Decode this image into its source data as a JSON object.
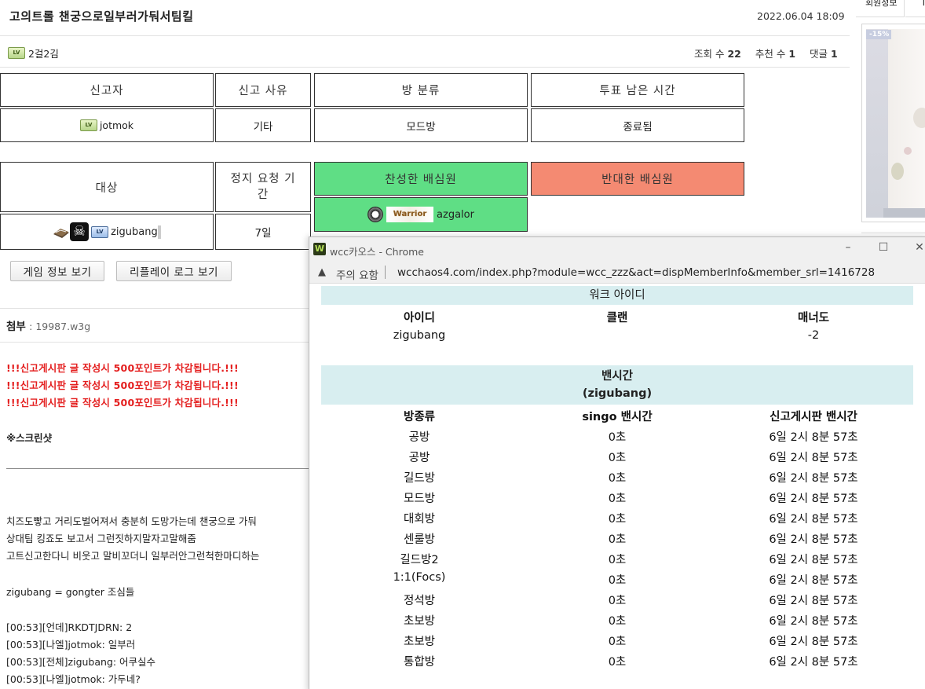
{
  "post": {
    "title": "고의트롤 챈궁으로일부러가둬서팀킬",
    "date": "2022.06.04 18:09",
    "author": "2걸2김",
    "views_label": "조회 수",
    "views": "22",
    "recommend_label": "추천 수",
    "recommend": "1",
    "comments_label": "댓글",
    "comments": "1"
  },
  "sidebar": {
    "tab1": "회원정보",
    "promo_tag": "-15%"
  },
  "report": {
    "headers": [
      "신고자",
      "신고 사유",
      "방 분류",
      "투표 남은 시간"
    ],
    "reporter": "jotmok",
    "reason": "기타",
    "room_type": "모드방",
    "time_left": "종료됨"
  },
  "target": {
    "header": "대상",
    "duration_header": "정지 요청 기간",
    "name": "zigubang",
    "duration": "7일",
    "agree_header": "찬성한 배심원",
    "disagree_header": "반대한 배심원",
    "agree_member": "azgalor",
    "agree_badge": "Warrior"
  },
  "buttons": {
    "game_info": "게임 정보 보기",
    "replay_log": "리플레이 로그 보기"
  },
  "attachment": {
    "label": "첨부",
    "file": ": 19987.w3g"
  },
  "body": {
    "warnings": [
      "!!!신고게시판 글 작성시 500포인트가 차감됩니다.!!!",
      "!!!신고게시판 글 작성시 500포인트가 차감됩니다.!!!",
      "!!!신고게시판 글 작성시 500포인트가 차감됩니다.!!!"
    ],
    "screenshot_heading": "※스크린샷",
    "lines": [
      "치즈도빻고 거리도벌어져서 충분히 도망가는데 챈궁으로 가둬",
      "상대팀 킹죠도 보고서 그런짓하지말자고말해줌",
      "고트신고한다니 비웃고 말비꼬더니 일부러안그런척한마디하는",
      "zigubang = gongter 조심들",
      "[00:53][언데]RKDTJDRN: 2",
      "[00:53][나엘]jotmok: 일부러",
      "[00:53][전체]zigubang: 어쿠실수",
      "[00:53][나엘]jotmok: 가두네?"
    ]
  },
  "popup": {
    "window_title": "wcc카오스 - Chrome",
    "security_label": "주의 요함",
    "url": "wcchaos4.com/index.php?module=wcc_zzz&act=dispMemberInfo&member_srl=1416728",
    "warcraft_id_title": "워크 아이디",
    "id_headers": [
      "아이디",
      "클랜",
      "매너도"
    ],
    "id_row": [
      "zigubang",
      "",
      "-2"
    ],
    "ban_title": "밴시간",
    "ban_subtitle": "(zigubang)",
    "ban_headers": [
      "방종류",
      "singo 밴시간",
      "신고게시판 밴시간"
    ],
    "ban_rows": [
      [
        "공방",
        "0초",
        "6일 2시 8분 57초"
      ],
      [
        "공방",
        "0초",
        "6일 2시 8분 57초"
      ],
      [
        "길드방",
        "0초",
        "6일 2시 8분 57초"
      ],
      [
        "모드방",
        "0초",
        "6일 2시 8분 57초"
      ],
      [
        "대회방",
        "0초",
        "6일 2시 8분 57초"
      ],
      [
        "센룰방",
        "0초",
        "6일 2시 8분 57초"
      ],
      [
        "길드방2",
        "0초",
        "6일 2시 8분 57초"
      ],
      [
        "1:1(Focs)",
        "0초",
        "6일 2시 8분 57초"
      ],
      [
        "정석방",
        "0초",
        "6일 2시 8분 57초"
      ],
      [
        "초보방",
        "0초",
        "6일 2시 8분 57초"
      ],
      [
        "초보방",
        "0초",
        "6일 2시 8분 57초"
      ],
      [
        "통합방",
        "0초",
        "6일 2시 8분 57초"
      ]
    ]
  }
}
